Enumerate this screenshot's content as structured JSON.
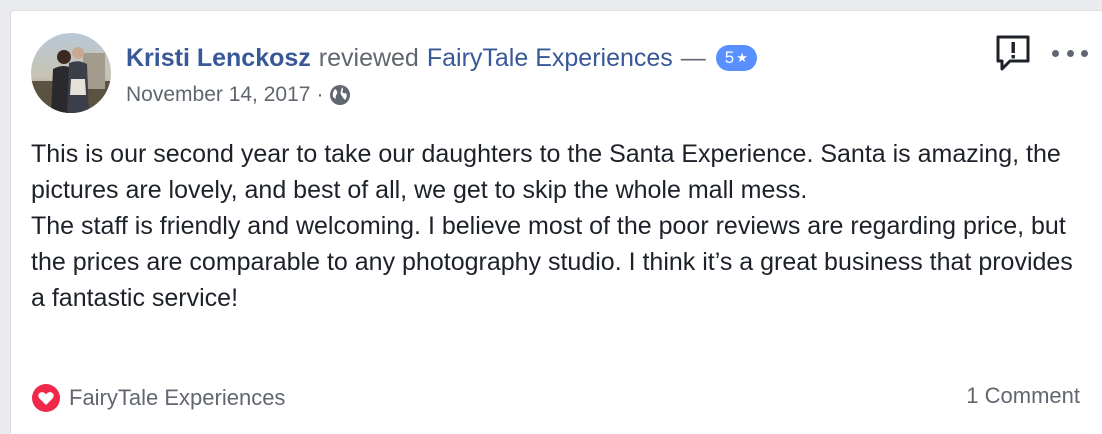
{
  "review": {
    "author": "Kristi Lenckosz",
    "action": "reviewed",
    "page_name": "FairyTale Experiences",
    "dash": "—",
    "rating_label": "5",
    "star": "★",
    "date": "November 14, 2017",
    "separator": "·",
    "privacy_icon": "globe-icon",
    "body": [
      "This is our second year to take our daughters to the Santa Experience. Santa is amazing, the pictures are lovely, and best of all, we get to skip the whole mall mess.",
      "The staff is friendly and welcoming. I believe most of the poor reviews are regarding price, but the prices are comparable to any photography studio. I think it’s a great business that provides a fantastic service!"
    ]
  },
  "actions": {
    "report_icon": "report-icon",
    "more_icon": "more-options-icon"
  },
  "footer": {
    "reaction_icon": "heart-reaction-icon",
    "reactor": "FairyTale Experiences",
    "comments": "1 Comment"
  },
  "colors": {
    "link": "#385898",
    "badge": "#5890ff",
    "text": "#1d2129",
    "muted": "#616770",
    "heart": "#f0284a"
  }
}
